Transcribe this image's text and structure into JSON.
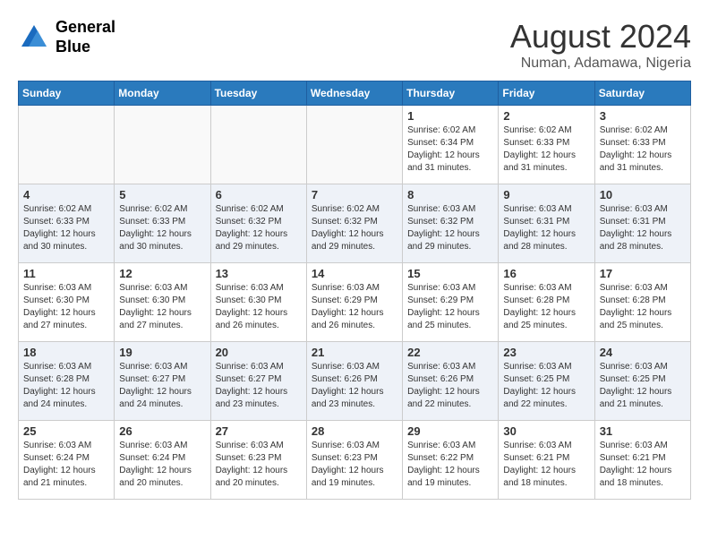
{
  "logo": {
    "general": "General",
    "blue": "Blue"
  },
  "header": {
    "month_year": "August 2024",
    "location": "Numan, Adamawa, Nigeria"
  },
  "days_of_week": [
    "Sunday",
    "Monday",
    "Tuesday",
    "Wednesday",
    "Thursday",
    "Friday",
    "Saturday"
  ],
  "weeks": [
    [
      {
        "day": "",
        "info": ""
      },
      {
        "day": "",
        "info": ""
      },
      {
        "day": "",
        "info": ""
      },
      {
        "day": "",
        "info": ""
      },
      {
        "day": "1",
        "info": "Sunrise: 6:02 AM\nSunset: 6:34 PM\nDaylight: 12 hours\nand 31 minutes."
      },
      {
        "day": "2",
        "info": "Sunrise: 6:02 AM\nSunset: 6:33 PM\nDaylight: 12 hours\nand 31 minutes."
      },
      {
        "day": "3",
        "info": "Sunrise: 6:02 AM\nSunset: 6:33 PM\nDaylight: 12 hours\nand 31 minutes."
      }
    ],
    [
      {
        "day": "4",
        "info": "Sunrise: 6:02 AM\nSunset: 6:33 PM\nDaylight: 12 hours\nand 30 minutes."
      },
      {
        "day": "5",
        "info": "Sunrise: 6:02 AM\nSunset: 6:33 PM\nDaylight: 12 hours\nand 30 minutes."
      },
      {
        "day": "6",
        "info": "Sunrise: 6:02 AM\nSunset: 6:32 PM\nDaylight: 12 hours\nand 29 minutes."
      },
      {
        "day": "7",
        "info": "Sunrise: 6:02 AM\nSunset: 6:32 PM\nDaylight: 12 hours\nand 29 minutes."
      },
      {
        "day": "8",
        "info": "Sunrise: 6:03 AM\nSunset: 6:32 PM\nDaylight: 12 hours\nand 29 minutes."
      },
      {
        "day": "9",
        "info": "Sunrise: 6:03 AM\nSunset: 6:31 PM\nDaylight: 12 hours\nand 28 minutes."
      },
      {
        "day": "10",
        "info": "Sunrise: 6:03 AM\nSunset: 6:31 PM\nDaylight: 12 hours\nand 28 minutes."
      }
    ],
    [
      {
        "day": "11",
        "info": "Sunrise: 6:03 AM\nSunset: 6:30 PM\nDaylight: 12 hours\nand 27 minutes."
      },
      {
        "day": "12",
        "info": "Sunrise: 6:03 AM\nSunset: 6:30 PM\nDaylight: 12 hours\nand 27 minutes."
      },
      {
        "day": "13",
        "info": "Sunrise: 6:03 AM\nSunset: 6:30 PM\nDaylight: 12 hours\nand 26 minutes."
      },
      {
        "day": "14",
        "info": "Sunrise: 6:03 AM\nSunset: 6:29 PM\nDaylight: 12 hours\nand 26 minutes."
      },
      {
        "day": "15",
        "info": "Sunrise: 6:03 AM\nSunset: 6:29 PM\nDaylight: 12 hours\nand 25 minutes."
      },
      {
        "day": "16",
        "info": "Sunrise: 6:03 AM\nSunset: 6:28 PM\nDaylight: 12 hours\nand 25 minutes."
      },
      {
        "day": "17",
        "info": "Sunrise: 6:03 AM\nSunset: 6:28 PM\nDaylight: 12 hours\nand 25 minutes."
      }
    ],
    [
      {
        "day": "18",
        "info": "Sunrise: 6:03 AM\nSunset: 6:28 PM\nDaylight: 12 hours\nand 24 minutes."
      },
      {
        "day": "19",
        "info": "Sunrise: 6:03 AM\nSunset: 6:27 PM\nDaylight: 12 hours\nand 24 minutes."
      },
      {
        "day": "20",
        "info": "Sunrise: 6:03 AM\nSunset: 6:27 PM\nDaylight: 12 hours\nand 23 minutes."
      },
      {
        "day": "21",
        "info": "Sunrise: 6:03 AM\nSunset: 6:26 PM\nDaylight: 12 hours\nand 23 minutes."
      },
      {
        "day": "22",
        "info": "Sunrise: 6:03 AM\nSunset: 6:26 PM\nDaylight: 12 hours\nand 22 minutes."
      },
      {
        "day": "23",
        "info": "Sunrise: 6:03 AM\nSunset: 6:25 PM\nDaylight: 12 hours\nand 22 minutes."
      },
      {
        "day": "24",
        "info": "Sunrise: 6:03 AM\nSunset: 6:25 PM\nDaylight: 12 hours\nand 21 minutes."
      }
    ],
    [
      {
        "day": "25",
        "info": "Sunrise: 6:03 AM\nSunset: 6:24 PM\nDaylight: 12 hours\nand 21 minutes."
      },
      {
        "day": "26",
        "info": "Sunrise: 6:03 AM\nSunset: 6:24 PM\nDaylight: 12 hours\nand 20 minutes."
      },
      {
        "day": "27",
        "info": "Sunrise: 6:03 AM\nSunset: 6:23 PM\nDaylight: 12 hours\nand 20 minutes."
      },
      {
        "day": "28",
        "info": "Sunrise: 6:03 AM\nSunset: 6:23 PM\nDaylight: 12 hours\nand 19 minutes."
      },
      {
        "day": "29",
        "info": "Sunrise: 6:03 AM\nSunset: 6:22 PM\nDaylight: 12 hours\nand 19 minutes."
      },
      {
        "day": "30",
        "info": "Sunrise: 6:03 AM\nSunset: 6:21 PM\nDaylight: 12 hours\nand 18 minutes."
      },
      {
        "day": "31",
        "info": "Sunrise: 6:03 AM\nSunset: 6:21 PM\nDaylight: 12 hours\nand 18 minutes."
      }
    ]
  ]
}
